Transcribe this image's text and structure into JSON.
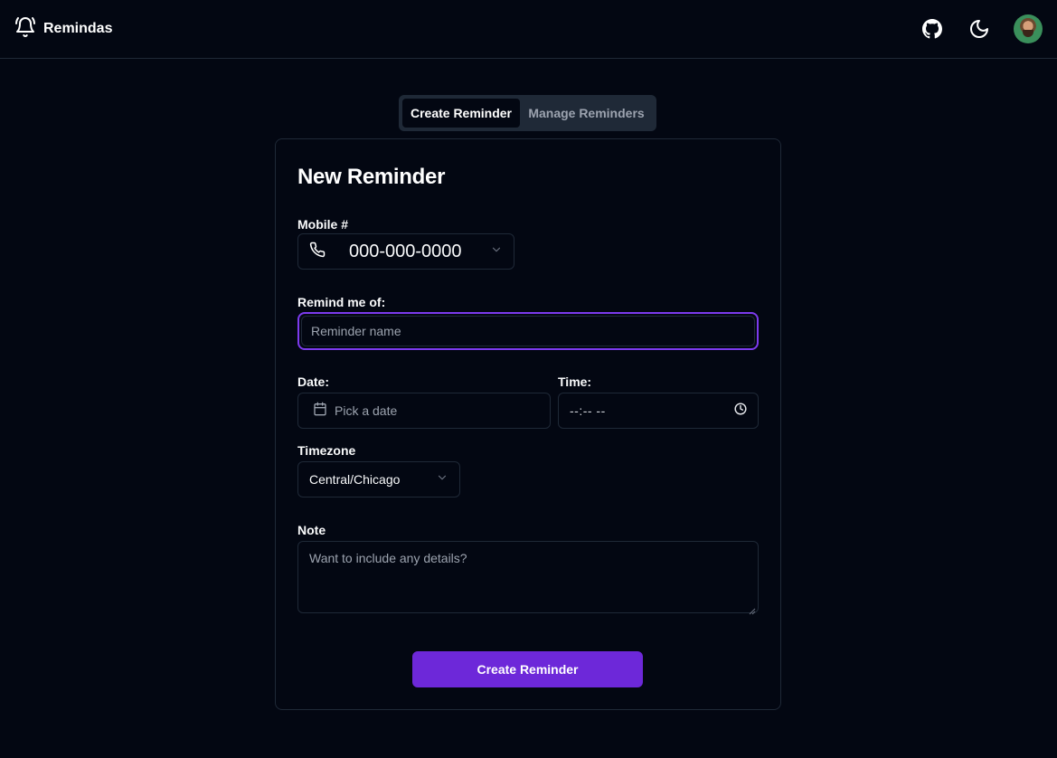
{
  "app": {
    "name": "Remindas"
  },
  "header": {
    "icons": [
      "bell-icon",
      "github-icon",
      "moon-icon",
      "avatar"
    ]
  },
  "tabs": [
    {
      "label": "Create Reminder",
      "active": true
    },
    {
      "label": "Manage Reminders",
      "active": false
    }
  ],
  "form": {
    "title": "New Reminder",
    "mobile": {
      "label": "Mobile #",
      "value": "000-000-0000"
    },
    "reminder": {
      "label": "Remind me of:",
      "placeholder": "Reminder name",
      "value": ""
    },
    "date": {
      "label": "Date:",
      "placeholder": "Pick a date"
    },
    "time": {
      "label": "Time:",
      "value": "--:-- --"
    },
    "timezone": {
      "label": "Timezone",
      "value": "Central/Chicago"
    },
    "note": {
      "label": "Note",
      "placeholder": "Want to include any details?"
    },
    "submit_label": "Create Reminder"
  },
  "colors": {
    "background": "#030712",
    "border": "#1f2937",
    "accent": "#6d28d9",
    "focus_ring": "#7c3aed",
    "muted_text": "#9ca3af"
  }
}
